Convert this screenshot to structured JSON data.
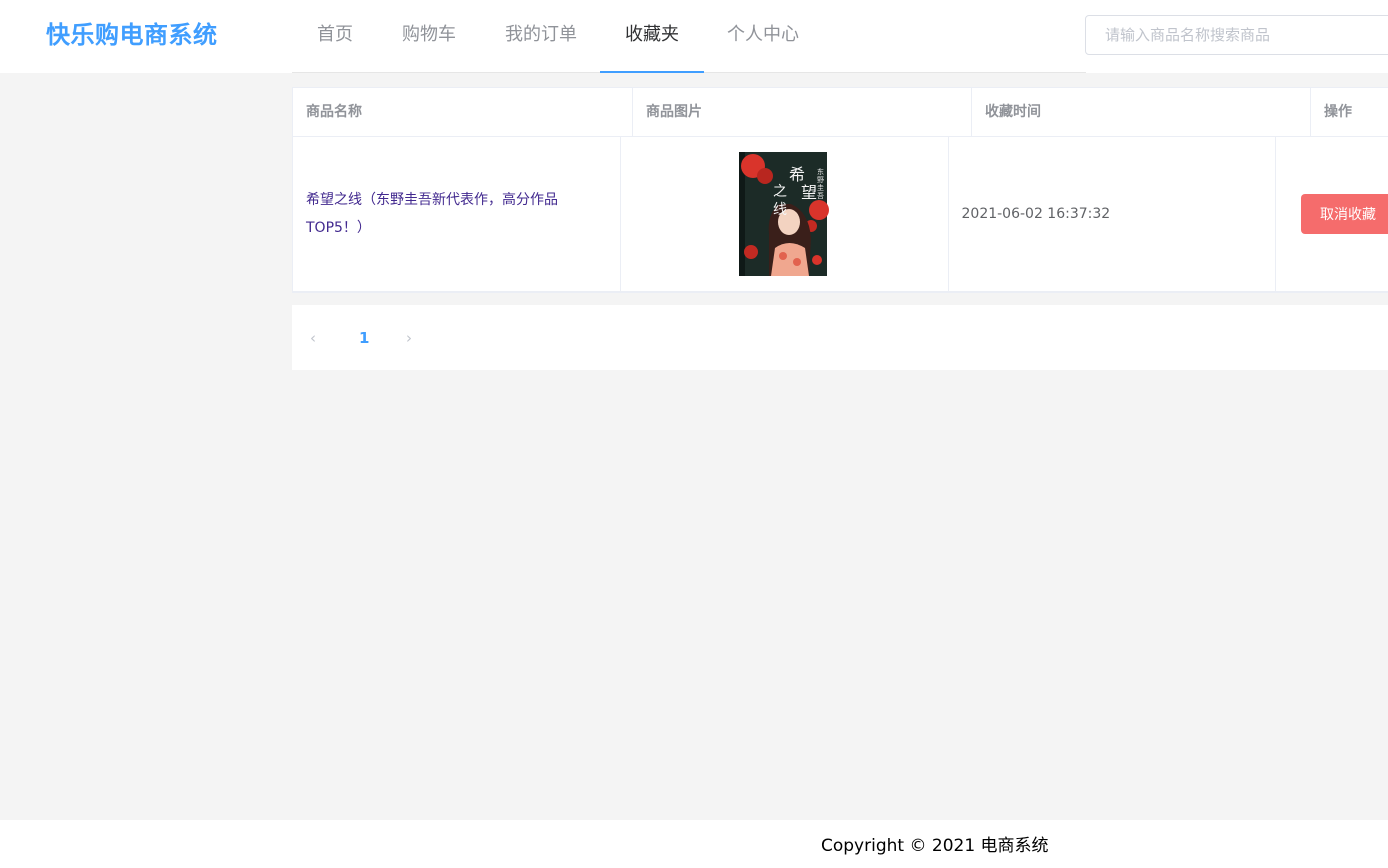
{
  "header": {
    "logo": "快乐购电商系统",
    "nav": [
      {
        "label": "首页"
      },
      {
        "label": "购物车"
      },
      {
        "label": "我的订单"
      },
      {
        "label": "收藏夹"
      },
      {
        "label": "个人中心"
      }
    ],
    "active_tab": "收藏夹",
    "search": {
      "placeholder": "请输入商品名称搜索商品",
      "value": ""
    }
  },
  "table": {
    "columns": [
      "商品名称",
      "商品图片",
      "收藏时间",
      "操作"
    ],
    "rows": [
      {
        "name": "希望之线（东野圭吾新代表作，高分作品TOP5！）",
        "cover_title": "希望之线",
        "cover_author": "东野圭吾",
        "time": "2021-06-02 16:37:32",
        "action": "取消收藏"
      }
    ]
  },
  "pagination": {
    "prev": "‹",
    "current": "1",
    "next": "›"
  },
  "footer": {
    "copyright": "Copyright © 2021 电商系统"
  },
  "colors": {
    "accent": "#409eff",
    "danger": "#f56c6c",
    "link": "#42298f"
  }
}
